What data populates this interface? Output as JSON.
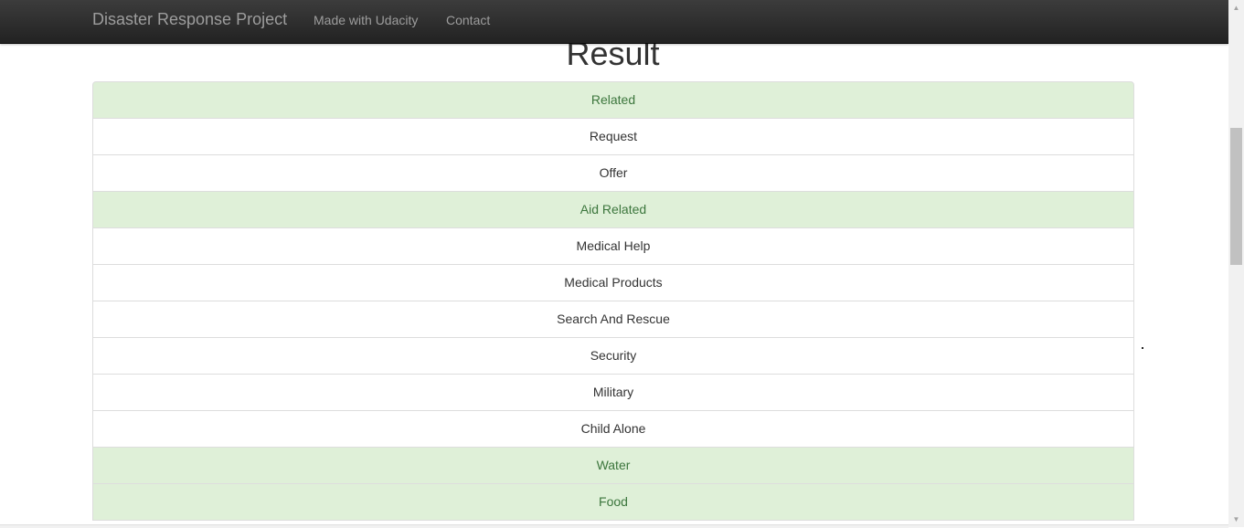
{
  "navbar": {
    "brand": "Disaster Response Project",
    "links": [
      {
        "label": "Made with Udacity"
      },
      {
        "label": "Contact"
      }
    ]
  },
  "main": {
    "title": "Result",
    "categories": [
      {
        "label": "Related",
        "active": true
      },
      {
        "label": "Request",
        "active": false
      },
      {
        "label": "Offer",
        "active": false
      },
      {
        "label": "Aid Related",
        "active": true
      },
      {
        "label": "Medical Help",
        "active": false
      },
      {
        "label": "Medical Products",
        "active": false
      },
      {
        "label": "Search And Rescue",
        "active": false
      },
      {
        "label": "Security",
        "active": false
      },
      {
        "label": "Military",
        "active": false
      },
      {
        "label": "Child Alone",
        "active": false
      },
      {
        "label": "Water",
        "active": true
      },
      {
        "label": "Food",
        "active": true
      }
    ]
  },
  "colors": {
    "navbar_bg": "#222222",
    "nav_text": "#9d9d9d",
    "success_bg": "#dff0d8",
    "success_text": "#3c763d",
    "default_text": "#333333"
  },
  "icons": {
    "scroll_up": "scroll-up-arrow-icon",
    "scroll_down": "scroll-down-arrow-icon"
  }
}
